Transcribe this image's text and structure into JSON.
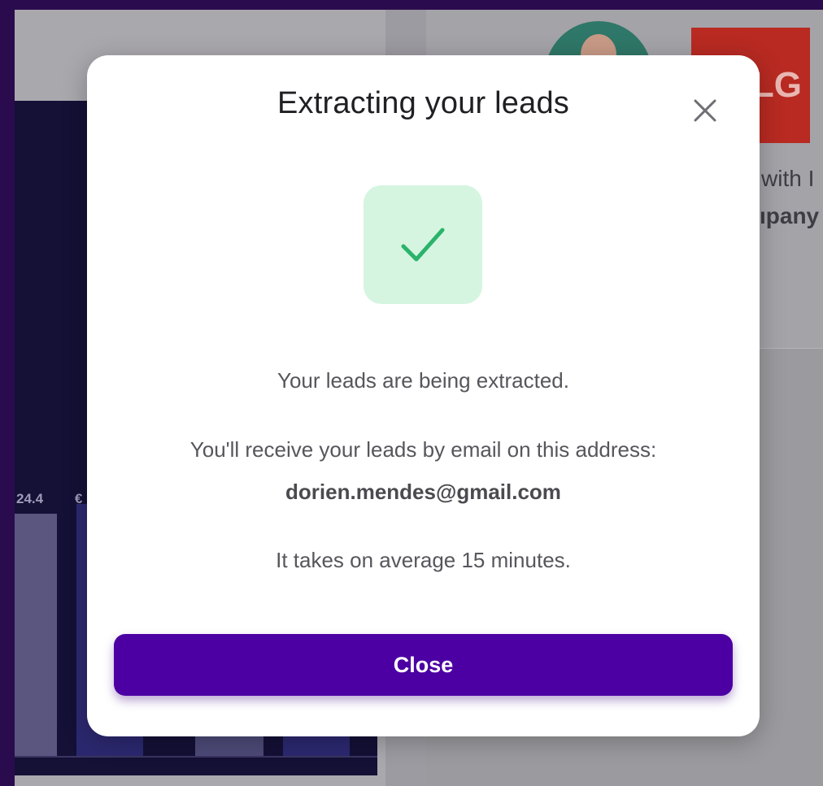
{
  "background": {
    "chart_labels": [
      "24.4",
      "€"
    ],
    "logo_text": "LG",
    "snippet_line1": "with I",
    "snippet_line2": "ıpany"
  },
  "modal": {
    "title": "Extracting your leads",
    "status_icon": "check-icon",
    "message": "Your leads are being extracted.",
    "email_intro": "You'll receive your leads by email on this address:",
    "email": "dorien.mendes@gmail.com",
    "duration_note": "It takes on average 15 minutes.",
    "close_button_label": "Close",
    "close_icon": "close-icon"
  },
  "colors": {
    "accent": "#4c00a3",
    "success_tile": "#d5f5e0",
    "success_check": "#2bb36b",
    "logo_red": "#b82a22"
  }
}
